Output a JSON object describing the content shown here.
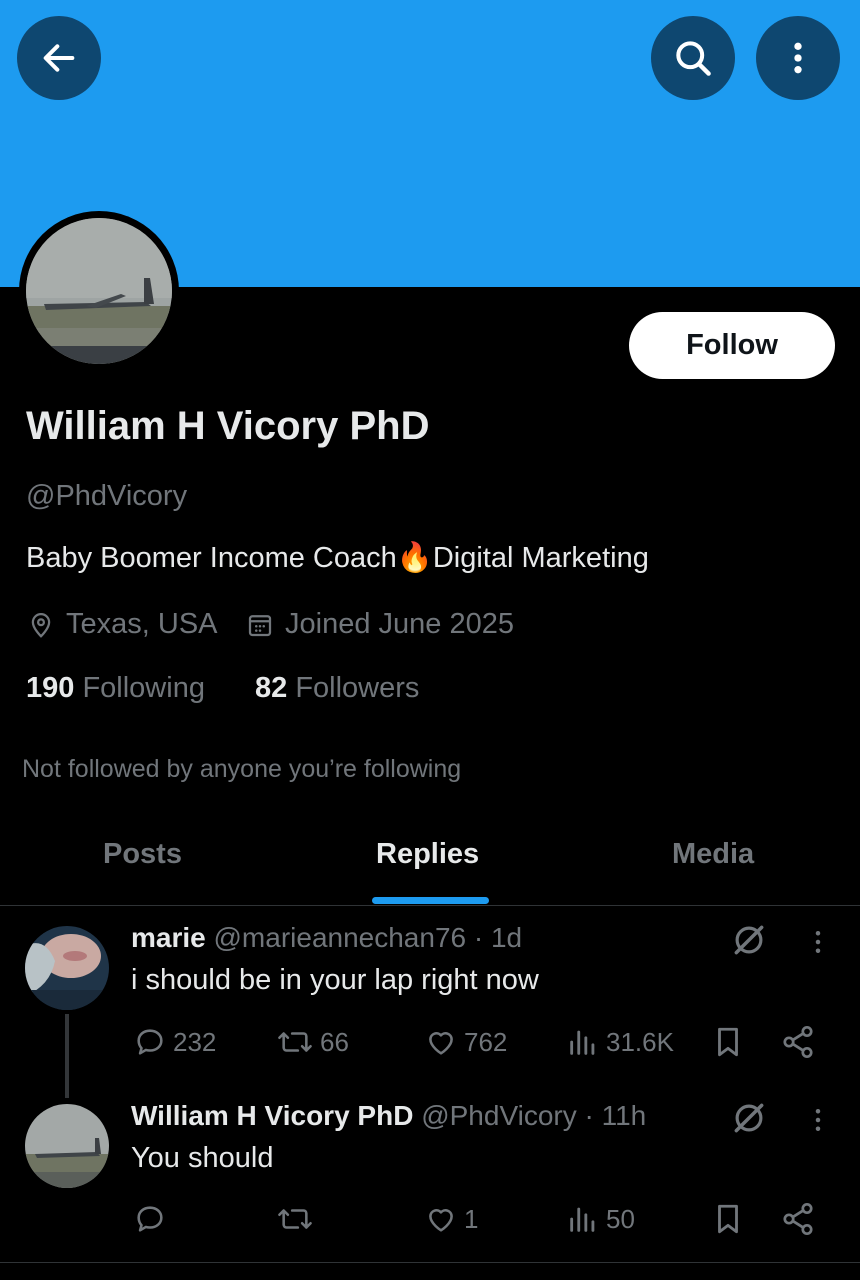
{
  "header": {
    "back_icon": "arrow-left-icon",
    "search_icon": "search-icon",
    "more_icon": "more-vertical-icon",
    "banner_color": "#1d9bf0"
  },
  "profile": {
    "follow_label": "Follow",
    "display_name": "William H Vicory PhD",
    "handle": "@PhdVicory",
    "bio": "Baby Boomer Income Coach🔥Digital Marketing",
    "location": "Texas, USA",
    "joined": "Joined June 2025",
    "following_count": "190",
    "following_label": "Following",
    "followers_count": "82",
    "followers_label": "Followers",
    "mutuals_note": "Not followed by anyone you’re following"
  },
  "tabs": [
    {
      "label": "Posts",
      "active": false
    },
    {
      "label": "Replies",
      "active": true
    },
    {
      "label": "Media",
      "active": false
    }
  ],
  "posts": [
    {
      "name": "marie",
      "meta": "@marieannechan76 · 1d",
      "text": "i should be in your lap right now",
      "replies": "232",
      "reposts": "66",
      "likes": "762",
      "views": "31.6K"
    },
    {
      "name": "William H Vicory PhD",
      "meta": "@PhdVicory · 11h",
      "text": "You should",
      "replies": "",
      "reposts": "",
      "likes": "1",
      "views": "50"
    }
  ],
  "colors": {
    "accent": "#1d9bf0",
    "muted": "#71767b",
    "text": "#e7e9ea",
    "bg": "#000000"
  }
}
